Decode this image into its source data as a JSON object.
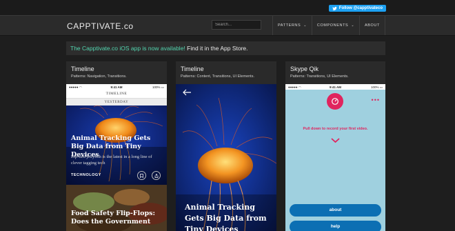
{
  "top": {
    "twitter_button": "Follow @capptivateco"
  },
  "nav": {
    "brand": "CAPPTIVATE.co",
    "search_placeholder": "Search...",
    "items": [
      {
        "label": "PATTERNS",
        "dropdown": true
      },
      {
        "label": "COMPONENTS",
        "dropdown": true
      },
      {
        "label": "ABOUT",
        "dropdown": false
      }
    ]
  },
  "banner": {
    "highlight": "The Capptivate.co iOS app is now available!",
    "rest": " Find it in the App Store."
  },
  "cards": [
    {
      "title": "Timeline",
      "subtitle": "Patterns: Navigation, Transitions.",
      "phone": {
        "status_time": "9:41 AM",
        "status_battery": "100%",
        "header": "TIMELINE",
        "subheader": "YESTERDAY",
        "headline": "Animal Tracking Gets Big Data from Tiny Devices",
        "summary": "Zip-tied jellyfish is the latest in a long line of clever tagging tech",
        "tag": "TECHNOLOGY",
        "headline2": "Food Safety Flip-Flops: Does the Government"
      }
    },
    {
      "title": "Timeline",
      "subtitle": "Patterns: Content, Transitions, UI Elements.",
      "phone": {
        "headline": "Animal Tracking Gets Big Data from Tiny Devices"
      }
    },
    {
      "title": "Skype Qik",
      "subtitle": "Patterns: Transitions, UI Elements.",
      "phone": {
        "status_time": "9:41 AM",
        "status_battery": "100%",
        "prompt": "Pull down to record your first video.",
        "buttons": [
          "about",
          "help"
        ]
      }
    }
  ],
  "colors": {
    "accent": "#53d6b0",
    "twitter": "#1da1f2",
    "skype_blue": "#0c6fb3",
    "skype_pink": "#e0245e"
  }
}
